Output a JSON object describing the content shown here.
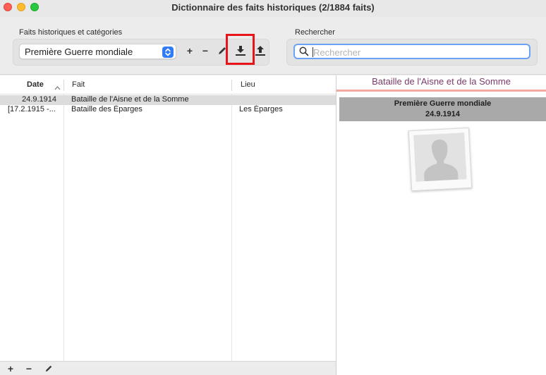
{
  "window": {
    "title": "Dictionnaire des faits historiques (2/1884 faits)"
  },
  "toolbar": {
    "category_group_label": "Faits historiques et catégories",
    "category_selected": "Première Guerre mondiale",
    "add_label": "+",
    "remove_label": "−",
    "search_group_label": "Rechercher",
    "search_placeholder": "Rechercher",
    "search_value": ""
  },
  "table": {
    "columns": [
      "Date",
      "Fait",
      "Lieu"
    ],
    "rows": [
      {
        "date": "24.9.1914",
        "fait": "Bataille de l'Aisne et de la Somme",
        "lieu": ""
      },
      {
        "date": "[17.2.1915 -...",
        "fait": "Bataille des Éparges",
        "lieu": "Les Éparges"
      }
    ],
    "selected_row": 0,
    "bottom_add_label": "+",
    "bottom_remove_label": "−"
  },
  "detail": {
    "title": "Bataille de l'Aisne et de la Somme",
    "category": "Première Guerre mondiale",
    "date": "24.9.1914"
  },
  "colors": {
    "accent": "#2f7cf6",
    "detail_title": "#7b3b6a",
    "detail_rule": "#f0a8a0",
    "highlight_box": "#e8141a"
  },
  "icons": {
    "edit": "pencil-icon",
    "import": "download-tray-icon",
    "export": "upload-tray-icon",
    "search": "magnifier-icon",
    "sort": "chevron-up-icon",
    "placeholder_photo": "person-silhouette-icon"
  }
}
